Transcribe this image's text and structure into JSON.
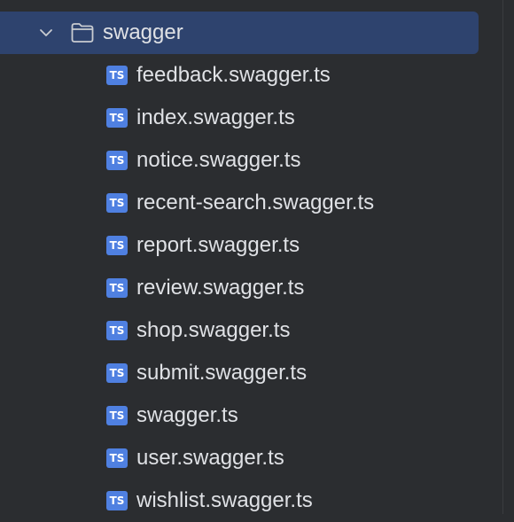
{
  "tree": {
    "folder": {
      "name": "swagger",
      "icon": "folder-icon",
      "expanded": true,
      "selected": true
    },
    "files": [
      {
        "name": "feedback.swagger.ts",
        "badge": "TS"
      },
      {
        "name": "index.swagger.ts",
        "badge": "TS"
      },
      {
        "name": "notice.swagger.ts",
        "badge": "TS"
      },
      {
        "name": "recent-search.swagger.ts",
        "badge": "TS"
      },
      {
        "name": "report.swagger.ts",
        "badge": "TS"
      },
      {
        "name": "review.swagger.ts",
        "badge": "TS"
      },
      {
        "name": "shop.swagger.ts",
        "badge": "TS"
      },
      {
        "name": "submit.swagger.ts",
        "badge": "TS"
      },
      {
        "name": "swagger.ts",
        "badge": "TS"
      },
      {
        "name": "user.swagger.ts",
        "badge": "TS"
      },
      {
        "name": "wishlist.swagger.ts",
        "badge": "TS"
      }
    ]
  },
  "colors": {
    "background": "#2b2d30",
    "selection": "#2e436e",
    "text": "#dfe1e5",
    "ts_badge": "#4f80e1"
  }
}
